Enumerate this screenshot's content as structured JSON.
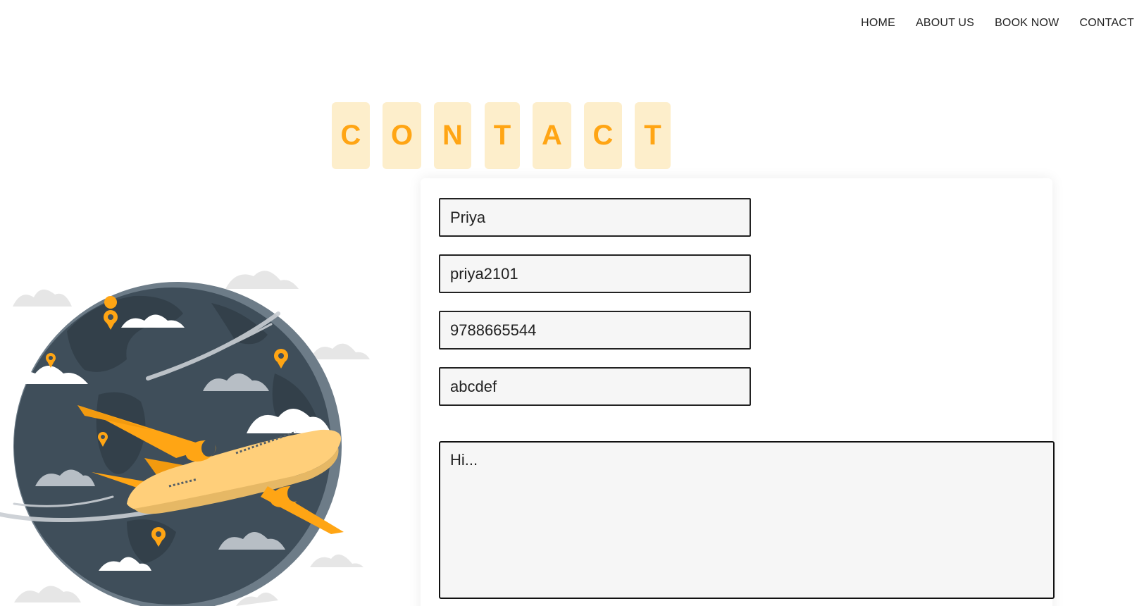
{
  "nav": {
    "items": [
      "HOME",
      "ABOUT US",
      "BOOK NOW",
      "CONTACT"
    ]
  },
  "title": {
    "letters": [
      "C",
      "O",
      "N",
      "T",
      "A",
      "C",
      "T"
    ]
  },
  "form": {
    "name_value": "Priya",
    "username_value": "priya2101",
    "phone_value": "9788665544",
    "password_value": "abcdef",
    "message_value": "Hi..."
  },
  "colors": {
    "accent": "#ffa514",
    "tile_bg": "#fdeecb",
    "globe": "#3f4e5a",
    "plane": "#ffb020"
  }
}
